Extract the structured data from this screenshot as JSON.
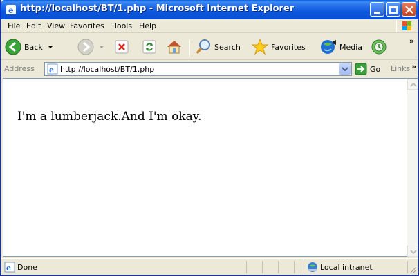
{
  "window": {
    "title": "http://localhost/BT/1.php - Microsoft Internet Explorer"
  },
  "menu": {
    "items": [
      {
        "label": "File"
      },
      {
        "label": "Edit"
      },
      {
        "label": "View"
      },
      {
        "label": "Favorites"
      },
      {
        "label": "Tools"
      },
      {
        "label": "Help"
      }
    ]
  },
  "toolbar": {
    "back_label": "Back",
    "search_label": "Search",
    "favorites_label": "Favorites",
    "media_label": "Media"
  },
  "address": {
    "label": "Address",
    "url": "http://localhost/BT/1.php",
    "go_label": "Go",
    "links_label": "Links"
  },
  "page": {
    "body_text": "I'm a lumberjack.And I'm okay."
  },
  "status": {
    "text": "Done",
    "zone": "Local intranet"
  },
  "colors": {
    "titlebar": "#0a5fe0",
    "chrome": "#ece9d8",
    "close_button": "#c3411e"
  }
}
